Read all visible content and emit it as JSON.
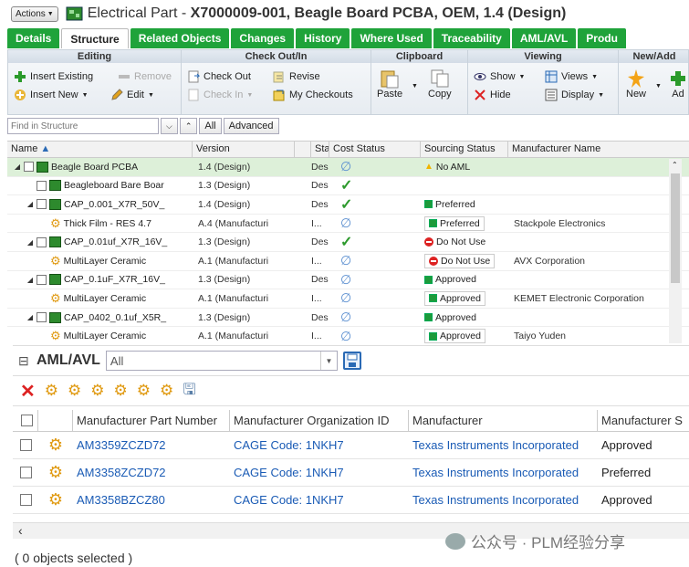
{
  "header": {
    "actions_label": "Actions",
    "title_prefix": "Electrical Part - ",
    "title_main": "X7000009-001, Beagle Board PCBA, OEM, 1.4 (Design)"
  },
  "tabs": [
    "Details",
    "Structure",
    "Related Objects",
    "Changes",
    "History",
    "Where Used",
    "Traceability",
    "AML/AVL",
    "Produ"
  ],
  "ribbon": {
    "editing": {
      "title": "Editing",
      "insert_existing": "Insert Existing",
      "remove": "Remove",
      "insert_new": "Insert New",
      "edit": "Edit"
    },
    "checkout": {
      "title": "Check Out/In",
      "check_out": "Check Out",
      "revise": "Revise",
      "check_in": "Check In",
      "my_checkouts": "My Checkouts"
    },
    "clipboard": {
      "title": "Clipboard",
      "paste": "Paste",
      "copy": "Copy"
    },
    "viewing": {
      "title": "Viewing",
      "show": "Show",
      "views": "Views",
      "hide": "Hide",
      "display": "Display"
    },
    "newadd": {
      "title": "New/Add",
      "new": "New",
      "add": "Ad"
    }
  },
  "find": {
    "placeholder": "Find in Structure",
    "all": "All",
    "advanced": "Advanced"
  },
  "grid": {
    "columns": {
      "name": "Name",
      "version": "Version",
      "state": "Sta",
      "cost": "Cost Status",
      "sourcing": "Sourcing Status",
      "manufacturer": "Manufacturer Name"
    },
    "rows": [
      {
        "name": "Beagle Board PCBA",
        "version": "1.4 (Design)",
        "state": "Des",
        "cost": "none",
        "sourcing": "No AML",
        "src_icon": "warn",
        "mfr": ""
      },
      {
        "name": "Beagleboard Bare Boar",
        "version": "1.3 (Design)",
        "state": "Des",
        "cost": "check",
        "sourcing": "",
        "src_icon": "",
        "mfr": ""
      },
      {
        "name": "CAP_0.001_X7R_50V_",
        "version": "1.4 (Design)",
        "state": "Des",
        "cost": "check",
        "sourcing": "Preferred",
        "src_icon": "sq",
        "mfr": ""
      },
      {
        "name": "Thick Film - RES 4.7",
        "version": "A.4 (Manufacturi",
        "state": "I...",
        "cost": "none",
        "sourcing": "Preferred",
        "src_icon": "sq",
        "mfr": "Stackpole Electronics"
      },
      {
        "name": "CAP_0.01uf_X7R_16V_",
        "version": "1.3 (Design)",
        "state": "Des",
        "cost": "check",
        "sourcing": "Do Not Use",
        "src_icon": "noent",
        "mfr": ""
      },
      {
        "name": "MultiLayer Ceramic",
        "version": "A.1 (Manufacturi",
        "state": "I...",
        "cost": "none",
        "sourcing": "Do Not Use",
        "src_icon": "noent",
        "mfr": "AVX Corporation"
      },
      {
        "name": "CAP_0.1uF_X7R_16V_",
        "version": "1.3 (Design)",
        "state": "Des",
        "cost": "none",
        "sourcing": "Approved",
        "src_icon": "sq",
        "mfr": ""
      },
      {
        "name": "MultiLayer Ceramic",
        "version": "A.1 (Manufacturi",
        "state": "I...",
        "cost": "none",
        "sourcing": "Approved",
        "src_icon": "sq",
        "mfr": "KEMET Electronic Corporation"
      },
      {
        "name": "CAP_0402_0.1uf_X5R_",
        "version": "1.3 (Design)",
        "state": "Des",
        "cost": "none",
        "sourcing": "Approved",
        "src_icon": "sq",
        "mfr": ""
      },
      {
        "name": "MultiLayer Ceramic",
        "version": "A.1 (Manufacturi",
        "state": "I...",
        "cost": "none",
        "sourcing": "Approved",
        "src_icon": "sq",
        "mfr": "Taiyo Yuden"
      }
    ]
  },
  "aml": {
    "title": "AML/AVL",
    "filter_value": "All",
    "columns": {
      "part_number": "Manufacturer Part Number",
      "org_id": "Manufacturer Organization ID",
      "manufacturer": "Manufacturer",
      "status": "Manufacturer S"
    },
    "rows": [
      {
        "part_number": "AM3359ZCZD72",
        "org_id": "CAGE Code: 1NKH7",
        "manufacturer": "Texas Instruments Incorporated",
        "status": "Approved"
      },
      {
        "part_number": "AM3358ZCZD72",
        "org_id": "CAGE Code: 1NKH7",
        "manufacturer": "Texas Instruments Incorporated",
        "status": "Preferred"
      },
      {
        "part_number": "AM3358BZCZ80",
        "org_id": "CAGE Code: 1NKH7",
        "manufacturer": "Texas Instruments Incorporated",
        "status": "Approved"
      }
    ],
    "status_text": "( 0 objects selected )"
  },
  "watermark": "公众号 · PLM经验分享",
  "colors": {
    "tab_green": "#1fa33a",
    "link_blue": "#1a5bb5",
    "gear_orange": "#e09a12"
  }
}
